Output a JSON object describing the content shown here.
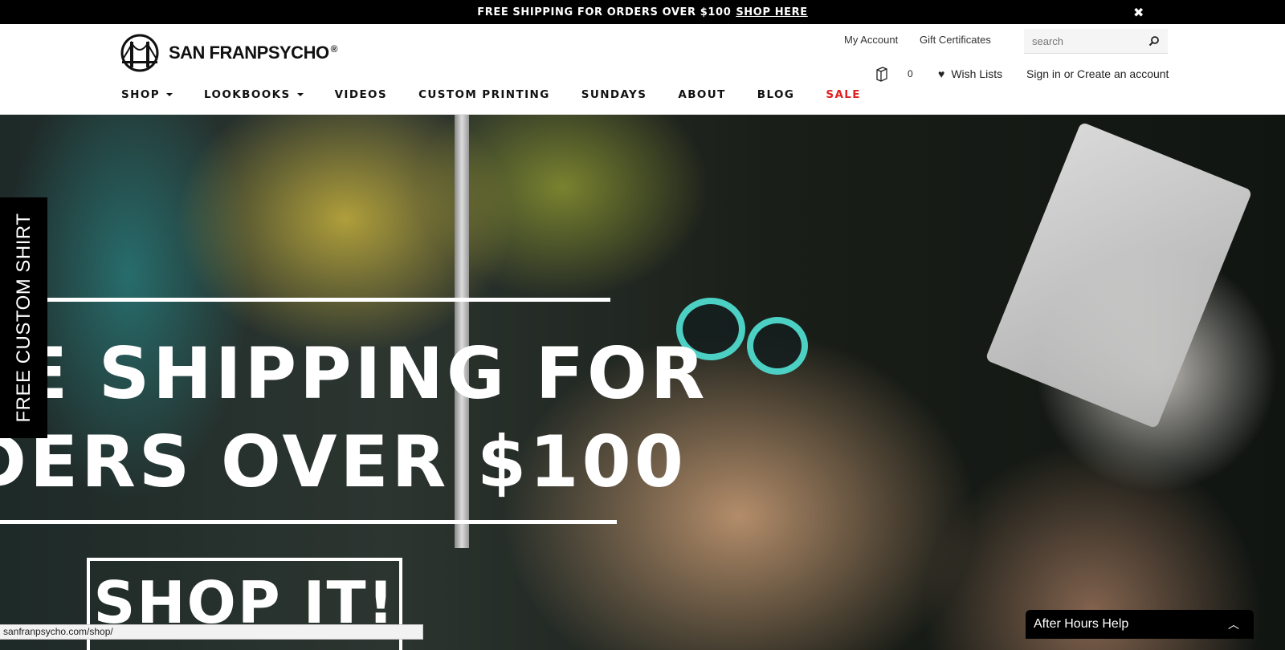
{
  "topbar": {
    "text": "FREE SHIPPING FOR ORDERS OVER $100",
    "link_label": "SHOP HERE",
    "close_icon": "close-icon"
  },
  "header": {
    "logo_text": "SAN FRANPSYCHO",
    "logo_reg": "®",
    "my_account": "My Account",
    "gift_certificates": "Gift Certificates",
    "search_placeholder": "search",
    "cart_count": "0",
    "wish_lists": "Wish Lists",
    "sign_in": "Sign in or Create an account"
  },
  "nav": {
    "items": [
      {
        "label": "SHOP"
      },
      {
        "label": "LOOKBOOKS"
      },
      {
        "label": "VIDEOS"
      },
      {
        "label": "CUSTOM PRINTING"
      },
      {
        "label": "SUNDAYS"
      },
      {
        "label": "ABOUT"
      },
      {
        "label": "BLOG"
      },
      {
        "label": "SALE"
      }
    ]
  },
  "hero": {
    "headline_line1": "EE SHIPPING FOR",
    "headline_line2": "DERS OVER $100",
    "cta": "SHOP IT!"
  },
  "side_tab": {
    "label": "FREE CUSTOM SHIRT"
  },
  "status_bar": {
    "url": "sanfranpsycho.com/shop/"
  },
  "chat": {
    "label": "After Hours Help"
  },
  "colors": {
    "sale": "#e02020",
    "bar": "#000000",
    "glasses": "#4dd0c4"
  }
}
